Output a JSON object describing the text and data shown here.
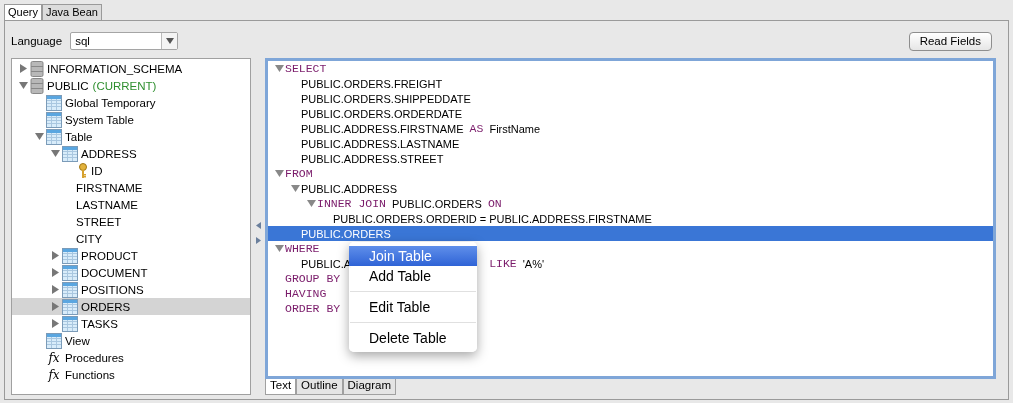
{
  "tabs": [
    {
      "label": "Query",
      "selected": true
    },
    {
      "label": "Java Bean",
      "selected": false
    }
  ],
  "language": {
    "label": "Language",
    "value": "sql"
  },
  "read_fields_button": "Read Fields",
  "tree": [
    {
      "label": "INFORMATION_SCHEMA",
      "kind": "schema",
      "expanded": false,
      "selected": false
    },
    {
      "label": "PUBLIC",
      "suffix": "(CURRENT)",
      "kind": "schema",
      "expanded": true,
      "selected": false,
      "children": [
        {
          "label": "Global Temporary",
          "kind": "table",
          "selected": false
        },
        {
          "label": "System Table",
          "kind": "table",
          "selected": false
        },
        {
          "label": "Table",
          "kind": "table",
          "expanded": true,
          "selected": false,
          "children": [
            {
              "label": "ADDRESS",
              "kind": "table",
              "expanded": true,
              "selected": false,
              "children": [
                {
                  "label": "ID",
                  "kind": "key",
                  "selected": false
                },
                {
                  "label": "FIRSTNAME",
                  "kind": "column",
                  "selected": false
                },
                {
                  "label": "LASTNAME",
                  "kind": "column",
                  "selected": false
                },
                {
                  "label": "STREET",
                  "kind": "column",
                  "selected": false
                },
                {
                  "label": "CITY",
                  "kind": "column",
                  "selected": false
                }
              ]
            },
            {
              "label": "PRODUCT",
              "kind": "table",
              "expanded": false,
              "selected": false
            },
            {
              "label": "DOCUMENT",
              "kind": "table",
              "expanded": false,
              "selected": false
            },
            {
              "label": "POSITIONS",
              "kind": "table",
              "expanded": false,
              "selected": false
            },
            {
              "label": "ORDERS",
              "kind": "table",
              "expanded": false,
              "selected": true
            },
            {
              "label": "TASKS",
              "kind": "table",
              "expanded": false,
              "selected": false
            }
          ]
        },
        {
          "label": "View",
          "kind": "table",
          "selected": false
        },
        {
          "label": "Procedures",
          "kind": "function",
          "glyph": "fx",
          "selected": false
        },
        {
          "label": "Functions",
          "kind": "function",
          "glyph": "fx",
          "selected": false
        }
      ]
    }
  ],
  "editor": [
    {
      "tokens": [
        {
          "kind": "keyword",
          "text": "SELECT"
        }
      ],
      "expanded": true,
      "selected": false,
      "children": [
        {
          "tokens": [
            {
              "kind": "plain",
              "text": "PUBLIC.ORDERS.FREIGHT"
            }
          ],
          "selected": false
        },
        {
          "tokens": [
            {
              "kind": "plain",
              "text": "PUBLIC.ORDERS.SHIPPEDDATE"
            }
          ],
          "selected": false
        },
        {
          "tokens": [
            {
              "kind": "plain",
              "text": "PUBLIC.ORDERS.ORDERDATE"
            }
          ],
          "selected": false
        },
        {
          "tokens": [
            {
              "kind": "plain",
              "text": "PUBLIC.ADDRESS.FIRSTNAME"
            },
            {
              "kind": "keyword",
              "text": "AS"
            },
            {
              "kind": "plain",
              "text": "FirstName"
            }
          ],
          "selected": false
        },
        {
          "tokens": [
            {
              "kind": "plain",
              "text": "PUBLIC.ADDRESS.LASTNAME"
            }
          ],
          "selected": false
        },
        {
          "tokens": [
            {
              "kind": "plain",
              "text": "PUBLIC.ADDRESS.STREET"
            }
          ],
          "selected": false
        }
      ]
    },
    {
      "tokens": [
        {
          "kind": "keyword",
          "text": "FROM"
        }
      ],
      "expanded": true,
      "selected": false,
      "children": [
        {
          "tokens": [
            {
              "kind": "plain",
              "text": "PUBLIC.ADDRESS"
            }
          ],
          "expanded": true,
          "selected": false,
          "children": [
            {
              "tokens": [
                {
                  "kind": "keyword",
                  "text": "INNER JOIN"
                },
                {
                  "kind": "plain",
                  "text": "PUBLIC.ORDERS"
                },
                {
                  "kind": "keyword",
                  "text": "ON"
                }
              ],
              "expanded": true,
              "selected": false,
              "children": [
                {
                  "tokens": [
                    {
                      "kind": "plain",
                      "text": "PUBLIC.ORDERS.ORDERID = PUBLIC.ADDRESS.FIRSTNAME"
                    }
                  ],
                  "selected": false
                }
              ]
            }
          ]
        },
        {
          "tokens": [
            {
              "kind": "plain",
              "text": "PUBLIC.ORDERS"
            }
          ],
          "selected": true
        }
      ]
    },
    {
      "tokens": [
        {
          "kind": "keyword",
          "text": "WHERE"
        }
      ],
      "expanded": true,
      "selected": false,
      "children": [
        {
          "tokens": [
            {
              "kind": "plain",
              "text": "PUBLIC.A"
            },
            {
              "kind": "covered"
            },
            {
              "kind": "keyword",
              "text": "LIKE"
            },
            {
              "kind": "plain",
              "text": "'A%'"
            }
          ],
          "selected": false
        }
      ]
    },
    {
      "tokens": [
        {
          "kind": "keyword",
          "text": "GROUP BY"
        }
      ],
      "selected": false
    },
    {
      "tokens": [
        {
          "kind": "keyword",
          "text": "HAVING"
        }
      ],
      "selected": false
    },
    {
      "tokens": [
        {
          "kind": "keyword",
          "text": "ORDER BY"
        }
      ],
      "selected": false
    }
  ],
  "context_menu": [
    {
      "kind": "item",
      "label": "Join Table",
      "selected": true
    },
    {
      "kind": "item",
      "label": "Add Table",
      "selected": false
    },
    {
      "kind": "separator"
    },
    {
      "kind": "item",
      "label": "Edit Table",
      "selected": false
    },
    {
      "kind": "separator"
    },
    {
      "kind": "item",
      "label": "Delete Table",
      "selected": false
    }
  ],
  "view_tabs": [
    {
      "label": "Text",
      "selected": true
    },
    {
      "label": "Outline",
      "selected": false
    },
    {
      "label": "Diagram",
      "selected": false
    }
  ]
}
